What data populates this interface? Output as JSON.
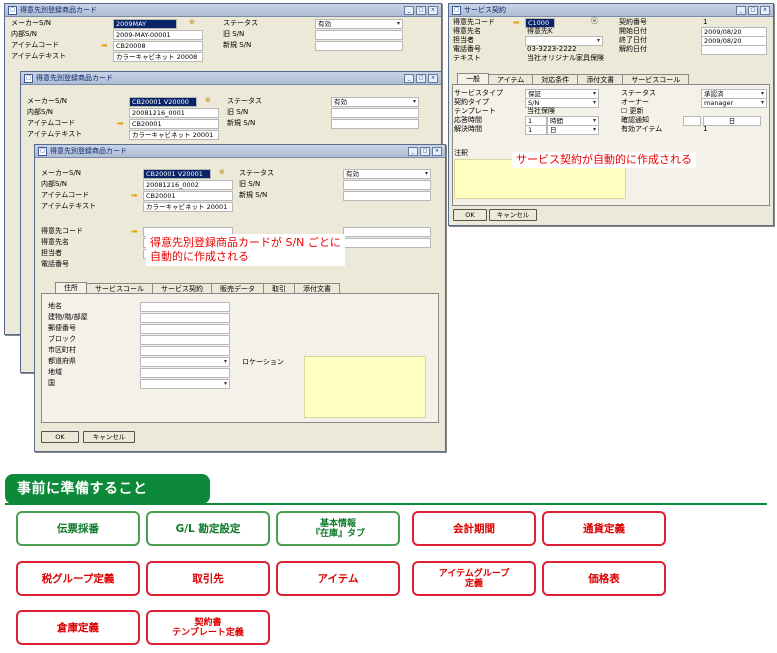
{
  "win_common": {
    "title": "得意先別登録商品カード",
    "maker_sn_label": "メーカーS/N",
    "internal_sn_label": "内部S/N",
    "item_code_label": "アイテムコード",
    "item_text_label": "アイテムテキスト",
    "status_label": "ステータス",
    "status_value": "有効",
    "old_sn_label": "旧 S/N",
    "new_sn_label": "新規 S/N"
  },
  "win1": {
    "maker_sn": "2009MAY",
    "internal_sn": "2009-MAY-00001",
    "item_code": "CB20008",
    "item_text": "カラーキャビネット 20008"
  },
  "win2": {
    "maker_sn": "CB20001 V20000",
    "internal_sn": "20081216_0001",
    "item_code": "CB20001",
    "item_text": "カラーキャビネット 20001"
  },
  "win3": {
    "maker_sn": "CB20001 V20001",
    "internal_sn": "20081216_0002",
    "item_code": "CB20001",
    "item_text": "カラーキャビネット 20001",
    "customer_code_label": "得意先コード",
    "customer_name_label": "得意先名",
    "contact_label": "担当者",
    "phone_label": "電話番号",
    "tabs": [
      "住所",
      "サービスコール",
      "サービス契約",
      "販売データ",
      "取引",
      "添付文書"
    ],
    "addr_labels": [
      "地名",
      "建物/階/部屋",
      "郵便番号",
      "ブロック",
      "市区町村",
      "都道府県",
      "地域",
      "国"
    ],
    "location_label": "ロケーション",
    "ok": "OK",
    "cancel": "キャンセル"
  },
  "note1": "得意先別登録商品カードが S/N ごとに\n自動的に作成される",
  "contract": {
    "title": "サービス契約",
    "left_labels": [
      "得意先コード",
      "得意先名",
      "担当者",
      "電話番号",
      "テキスト"
    ],
    "customer_code": "C1000",
    "customer_name": "得意先K",
    "contact": "",
    "phone": "03-3223-2222",
    "text": "当社オリジナル家具保険",
    "right_labels": [
      "契約番号",
      "開始日付",
      "終了日付",
      "解約日付"
    ],
    "contract_no": "1",
    "start_date": "2009/08/20",
    "end_date": "2009/08/20",
    "cancel_date": "",
    "tabs": [
      "一般",
      "アイテム",
      "対応条件",
      "添付文書",
      "サービスコール"
    ],
    "gen_left_labels": [
      "サービスタイプ",
      "契約タイプ",
      "テンプレート",
      "応答時間",
      "解決時間"
    ],
    "service_type": "保証",
    "contract_type": "S/N",
    "template": "当社保険",
    "response_time": "1",
    "response_unit": "時間",
    "resolve_time": "1",
    "resolve_unit": "日",
    "gen_right_labels": [
      "ステータス",
      "オーナー",
      "",
      "確認通知",
      "有効アイテム"
    ],
    "status": "承認済",
    "owner": "manager",
    "renewal": "更新",
    "confirm_unit": "日",
    "active_items": "1",
    "remarks_label": "注釈",
    "ok": "OK",
    "cancel": "キャンセル"
  },
  "note2": "サービス契約が自動的に作成される",
  "section_title": "事前に準備すること",
  "cards": [
    "伝票採番",
    "G/L 勘定設定",
    "基本情報\n『在庫』タブ",
    "会計期間",
    "通貨定義",
    "税グループ定義",
    "取引先",
    "アイテム",
    "アイテムグループ\n定義",
    "価格表",
    "倉庫定義",
    "契約書\nテンプレート定義"
  ],
  "colors": {
    "green": "#0c8a3a",
    "red": "#dd2233",
    "selected": "#0a246a",
    "field_yellow": "#ffffc0"
  }
}
